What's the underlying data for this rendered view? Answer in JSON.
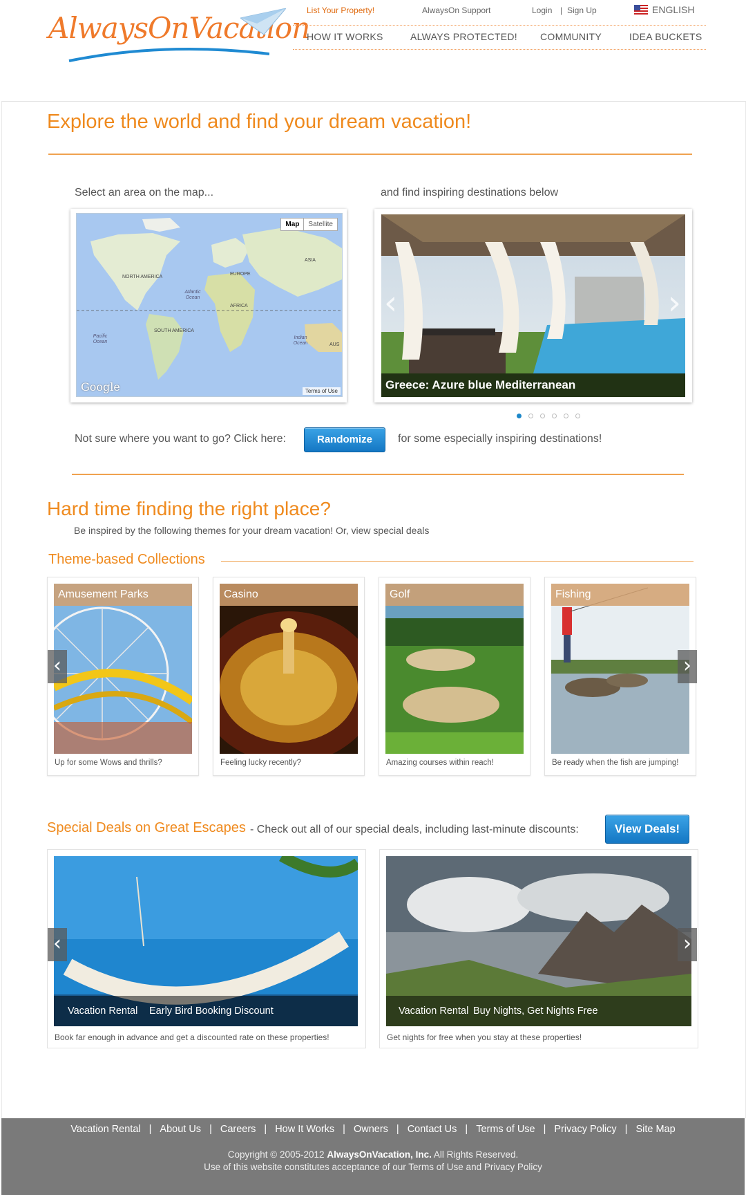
{
  "header": {
    "logo_text": "AlwaysOnVacation",
    "list_property": "List Your Property!",
    "support": "AlwaysOn Support",
    "login": "Login",
    "sign_up": "Sign Up",
    "language": "ENGLISH",
    "nav": [
      "HOW IT WORKS",
      "ALWAYS PROTECTED!",
      "COMMUNITY",
      "IDEA BUCKETS"
    ]
  },
  "explore": {
    "title": "Explore the world and find your dream vacation!",
    "map_prompt": "Select an area on the map...",
    "dest_prompt": "and find inspiring destinations below",
    "map_toggle": [
      "Map",
      "Satellite"
    ],
    "map_labels": {
      "north_america": "NORTH AMERICA",
      "south_america": "SOUTH AMERICA",
      "europe": "EUROPE",
      "asia": "ASIA",
      "africa": "AFRICA",
      "aus": "AUS",
      "atlantic": "Atlantic Ocean",
      "pacific": "Pacific Ocean",
      "indian": "Indian Ocean"
    },
    "google": "Google",
    "terms": "Terms of Use",
    "slide_caption": "Greece: Azure blue Mediterranean",
    "slide_count": 6,
    "slide_active": 1,
    "randomize_before": "Not sure where you want to go? Click here:",
    "randomize_button": "Randomize",
    "randomize_after": "for some especially inspiring destinations!"
  },
  "themes": {
    "title": "Hard time finding the right place?",
    "subtitle": "Be inspired by the following themes for your dream vacation! Or, view special deals",
    "collections_title": "Theme-based Collections",
    "cards": [
      {
        "title": "Amusement Parks",
        "desc": "Up for some Wows and thrills?"
      },
      {
        "title": "Casino",
        "desc": "Feeling lucky recently?"
      },
      {
        "title": "Golf",
        "desc": "Amazing courses within reach!"
      },
      {
        "title": "Fishing",
        "desc": "Be ready when the fish are jumping!"
      }
    ]
  },
  "deals": {
    "title": "Special Deals on Great Escapes",
    "subtitle": "- Check out all of our special deals, including last-minute discounts:",
    "button": "View Deals!",
    "cards": [
      {
        "type": "Vacation Rental",
        "name": "Early Bird Booking Discount",
        "desc": "Book far enough in advance and get a discounted rate on these properties!"
      },
      {
        "type": "Vacation Rental",
        "name": "Buy Nights, Get Nights Free",
        "desc": "Get nights for free when you stay at these properties!"
      }
    ]
  },
  "footer": {
    "links": [
      "Vacation Rental",
      "About Us",
      "Careers",
      "How It Works",
      "Owners",
      "Contact Us",
      "Terms of Use",
      "Privacy Policy",
      "Site Map"
    ],
    "copyright_pre": "Copyright © 2005-2012",
    "company": "AlwaysOnVacation, Inc.",
    "copyright_post": "All Rights Reserved.",
    "notice": "Use of this website constitutes acceptance of our Terms of Use and Privacy Policy"
  },
  "colors": {
    "accent": "#ef8a1e",
    "button_blue": "#1477c4",
    "footer": "#7a7a7a"
  }
}
